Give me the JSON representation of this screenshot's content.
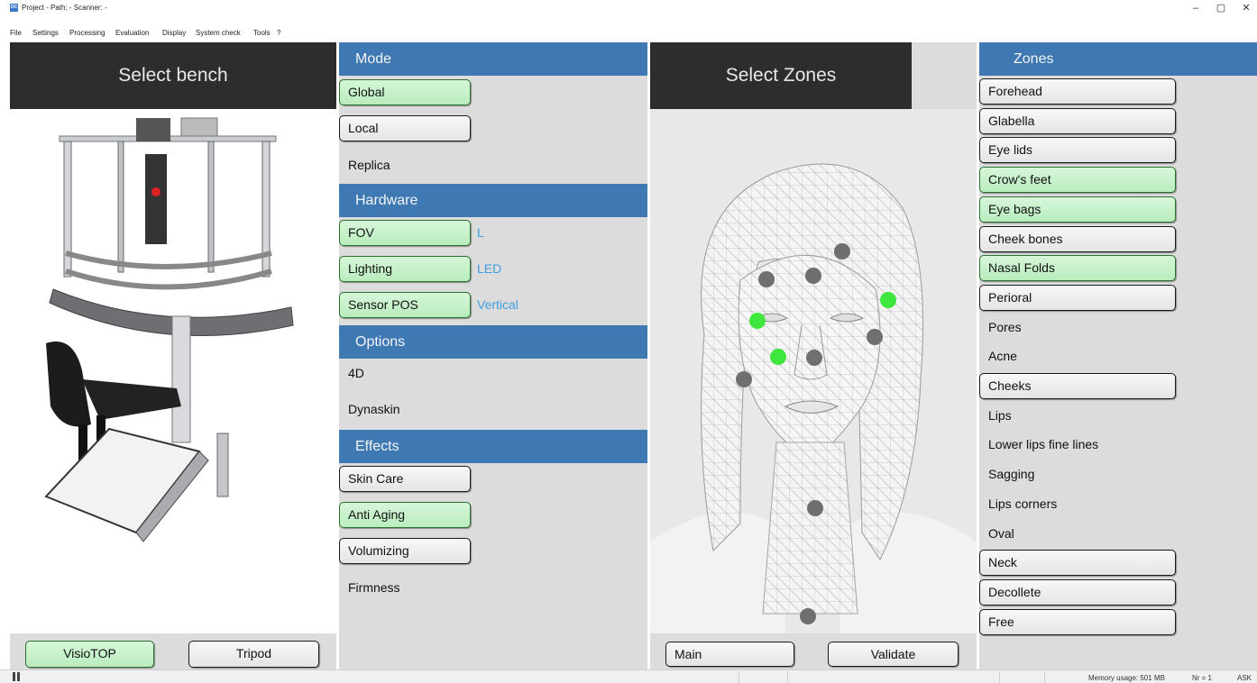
{
  "window": {
    "icon_text": "OC",
    "title": "Project - Path: - Scanner: -",
    "minimize": "–",
    "restore": "▢",
    "close": "✕"
  },
  "menu": [
    "File",
    "Settings",
    "Processing",
    "Evaluation",
    "Display",
    "System check",
    "Tools",
    "?"
  ],
  "bench": {
    "header": "Select bench",
    "image_icon": "visiotop-bench-image",
    "buttons": [
      {
        "label": "VisioTOP",
        "selected": true
      },
      {
        "label": "Tripod",
        "selected": false
      }
    ]
  },
  "mode": {
    "header": "Mode",
    "items": [
      {
        "label": "Global",
        "selected": true,
        "type": "button"
      },
      {
        "label": "Local",
        "selected": false,
        "type": "button"
      },
      {
        "label": "Replica",
        "selected": false,
        "type": "plain"
      }
    ]
  },
  "hardware": {
    "header": "Hardware",
    "items": [
      {
        "label": "FOV",
        "value": "L",
        "selected": true
      },
      {
        "label": "Lighting",
        "value": "LED",
        "selected": true
      },
      {
        "label": "Sensor POS",
        "value": "Vertical",
        "selected": true
      }
    ]
  },
  "options": {
    "header": "Options",
    "items": [
      "4D",
      "Dynaskin"
    ]
  },
  "effects": {
    "header": "Effects",
    "items": [
      {
        "label": "Skin Care",
        "selected": false,
        "type": "button"
      },
      {
        "label": "Anti Aging",
        "selected": true,
        "type": "button"
      },
      {
        "label": "Volumizing",
        "selected": false,
        "type": "button"
      },
      {
        "label": "Firmness",
        "selected": false,
        "type": "plain"
      }
    ]
  },
  "select_zones": {
    "header": "Select Zones",
    "image_icon": "face-mesh-image",
    "buttons": {
      "main": "Main",
      "validate": "Validate"
    },
    "colors": {
      "active_point": "#3ee63e",
      "inactive_point": "#6f6f6f"
    }
  },
  "zones": {
    "header": "Zones",
    "items": [
      {
        "label": "Forehead",
        "selected": false,
        "type": "button"
      },
      {
        "label": "Glabella",
        "selected": false,
        "type": "button"
      },
      {
        "label": "Eye lids",
        "selected": false,
        "type": "button"
      },
      {
        "label": "Crow's feet",
        "selected": true,
        "type": "button"
      },
      {
        "label": "Eye bags",
        "selected": true,
        "type": "button"
      },
      {
        "label": "Cheek bones",
        "selected": false,
        "type": "button"
      },
      {
        "label": "Nasal Folds",
        "selected": true,
        "type": "button"
      },
      {
        "label": "Perioral",
        "selected": false,
        "type": "button"
      },
      {
        "label": "Pores",
        "selected": false,
        "type": "plain"
      },
      {
        "label": "Acne",
        "selected": false,
        "type": "plain"
      },
      {
        "label": "Cheeks",
        "selected": false,
        "type": "button"
      },
      {
        "label": "Lips",
        "selected": false,
        "type": "plain"
      },
      {
        "label": "Lower lips fine lines",
        "selected": false,
        "type": "plain"
      },
      {
        "label": "Sagging",
        "selected": false,
        "type": "plain"
      },
      {
        "label": "Lips corners",
        "selected": false,
        "type": "plain"
      },
      {
        "label": "Oval",
        "selected": false,
        "type": "plain"
      },
      {
        "label": "Neck",
        "selected": false,
        "type": "button"
      },
      {
        "label": "Decollete",
        "selected": false,
        "type": "button"
      },
      {
        "label": "Free",
        "selected": false,
        "type": "button"
      }
    ]
  },
  "colors": {
    "header_blue": "#3f79b3",
    "header_dark": "#2d2d2d",
    "selected_green": "#c8f2cb",
    "value_blue": "#3ea0e0"
  },
  "status": {
    "memory": "Memory usage: 501 MB",
    "nr": "Nr = 1",
    "ask": "ASK"
  }
}
